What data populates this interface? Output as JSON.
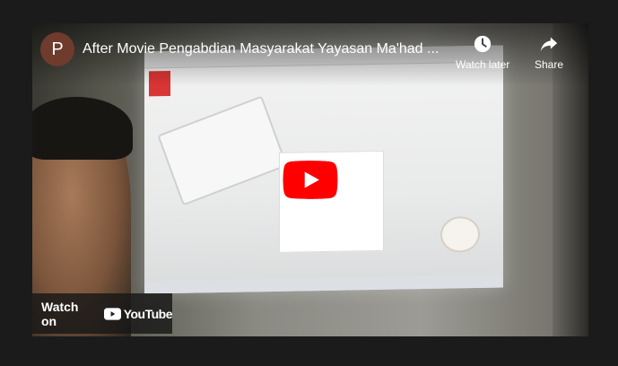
{
  "video": {
    "title": "After Movie Pengabdian Masyarakat Yayasan Ma'had ...",
    "channel_initial": "P"
  },
  "actions": {
    "watch_later": "Watch later",
    "share": "Share"
  },
  "footer": {
    "watch_on": "Watch on",
    "brand": "YouTube"
  },
  "icons": {
    "watch_later": "clock-icon",
    "share": "share-arrow-icon",
    "play": "play-icon",
    "youtube": "youtube-logo-icon"
  },
  "colors": {
    "play_red": "#ff0000",
    "page_bg": "#1b1b1b",
    "avatar_bg": "#6e3b2d"
  }
}
